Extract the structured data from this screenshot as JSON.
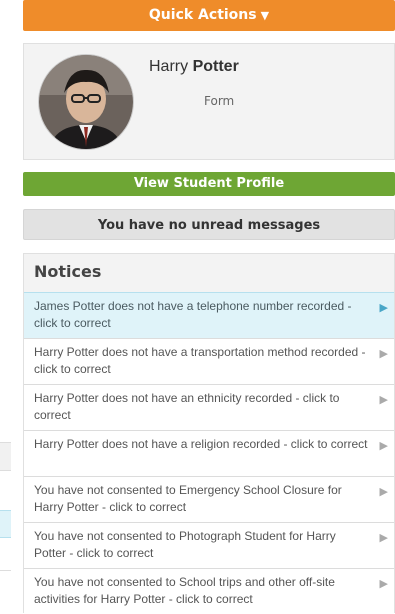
{
  "quick_actions": {
    "label": "Quick Actions",
    "caret": "▼"
  },
  "student": {
    "first_name": "Harry",
    "last_name": "Potter",
    "form_label": "Form"
  },
  "view_profile": {
    "label": "View Student Profile"
  },
  "messages": {
    "label": "You have no unread messages"
  },
  "notices": {
    "title": "Notices",
    "items": [
      {
        "text": "James Potter does not have a telephone number recorded - click to correct",
        "active": true
      },
      {
        "text": "Harry Potter does not have a transportation method recorded - click to correct",
        "active": false
      },
      {
        "text": "Harry Potter does not have an ethnicity recorded - click to correct",
        "active": false
      },
      {
        "text": "Harry Potter does not have a religion recorded - click to correct",
        "active": false
      },
      {
        "text": "You have not consented to Emergency School Closure for Harry Potter - click to correct",
        "active": false
      },
      {
        "text": "You have not consented to Photograph Student for Harry Potter - click to correct",
        "active": false
      },
      {
        "text": "You have not consented to School trips and other off-site activities for Harry Potter - click to correct",
        "active": false
      }
    ],
    "arrow_icon": "▶"
  },
  "colors": {
    "accent_orange": "#ef8c2a",
    "accent_green": "#6ea634",
    "active_row": "#dff3f9"
  }
}
